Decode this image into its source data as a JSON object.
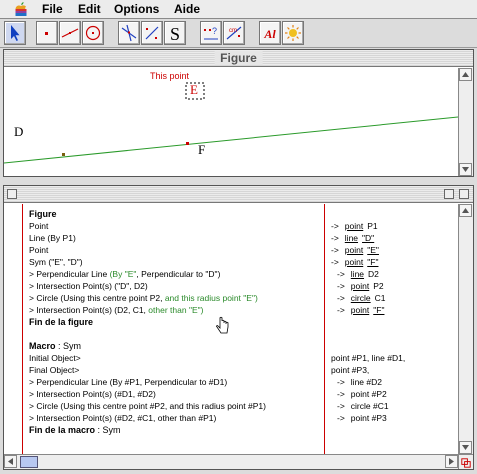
{
  "menu": {
    "items": [
      "File",
      "Edit",
      "Options",
      "Aide"
    ]
  },
  "toolbar": {
    "tools": [
      "pointer",
      "point",
      "line",
      "circle",
      "construct-lines",
      "construct-points",
      "symmetry",
      "macro",
      "measure",
      "text",
      "animate"
    ],
    "s_label": "S",
    "a_label": "Al"
  },
  "figure_window": {
    "title": "Figure",
    "this_point_label": "This point",
    "point_e": "E",
    "point_f": "F",
    "line_d": "D",
    "colors": {
      "line": "#2a9a2a",
      "label_red": "#cc0000"
    }
  },
  "history_window": {
    "left": [
      {
        "text": "Figure",
        "bold": true
      },
      {
        "text": "Point"
      },
      {
        "text": "Line (By P1)"
      },
      {
        "text": "Point"
      },
      {
        "text": "Sym (\"E\", \"D\")"
      },
      {
        "text": " >  Perpendicular Line ",
        "green": "(By \"E\"",
        "rest": ", Perpendicular to \"D\")"
      },
      {
        "text": " >  Intersection Point(s) (\"D\", D2)"
      },
      {
        "text": " >  Circle (Using this centre point P2, ",
        "green": "and this radius point \"E\")"
      },
      {
        "text": " >  Intersection Point(s) (D2, C1, ",
        "green": "other than \"E\")"
      },
      {
        "text": "Fin de la figure",
        "bold": true
      },
      {
        "text": ""
      },
      {
        "text": "Macro",
        "bold": true,
        "rest": " : Sym"
      },
      {
        "text": "Initial Object>"
      },
      {
        "text": "Final Object>"
      },
      {
        "text": " >  Perpendicular Line (By #P1, Perpendicular to #D1)"
      },
      {
        "text": " >  Intersection Point(s) (#D1, #D2)"
      },
      {
        "text": " >  Circle (Using this centre point #P2, and this radius point #P1)"
      },
      {
        "text": " >  Intersection Point(s) (#D2, #C1, other than #P1)"
      },
      {
        "text": "Fin de la macro",
        "bold": true,
        "rest": " : Sym"
      }
    ],
    "right": [
      {
        "arrow": "->",
        "word": "point",
        "name": "P1"
      },
      {
        "arrow": "->",
        "word": "line",
        "name": "\"D\""
      },
      {
        "arrow": "->",
        "word": "point",
        "name": "\"E\""
      },
      {
        "arrow": "->",
        "word": "point",
        "name": "\"F\""
      },
      {
        "arrow": "->",
        "word": "line",
        "name": "D2"
      },
      {
        "arrow": "->",
        "word": "point",
        "name": "P2"
      },
      {
        "arrow": "->",
        "word": "circle",
        "name": "C1"
      },
      {
        "arrow": "->",
        "word": "point",
        "name": "\"F\""
      },
      {
        "text": "point #P1, line #D1,"
      },
      {
        "text": "point #P3,"
      },
      {
        "arrow": "->",
        "text": "line #D2"
      },
      {
        "arrow": "->",
        "text": "point #P2"
      },
      {
        "arrow": "->",
        "text": "circle #C1"
      },
      {
        "arrow": "->",
        "text": "point #P3"
      }
    ]
  }
}
